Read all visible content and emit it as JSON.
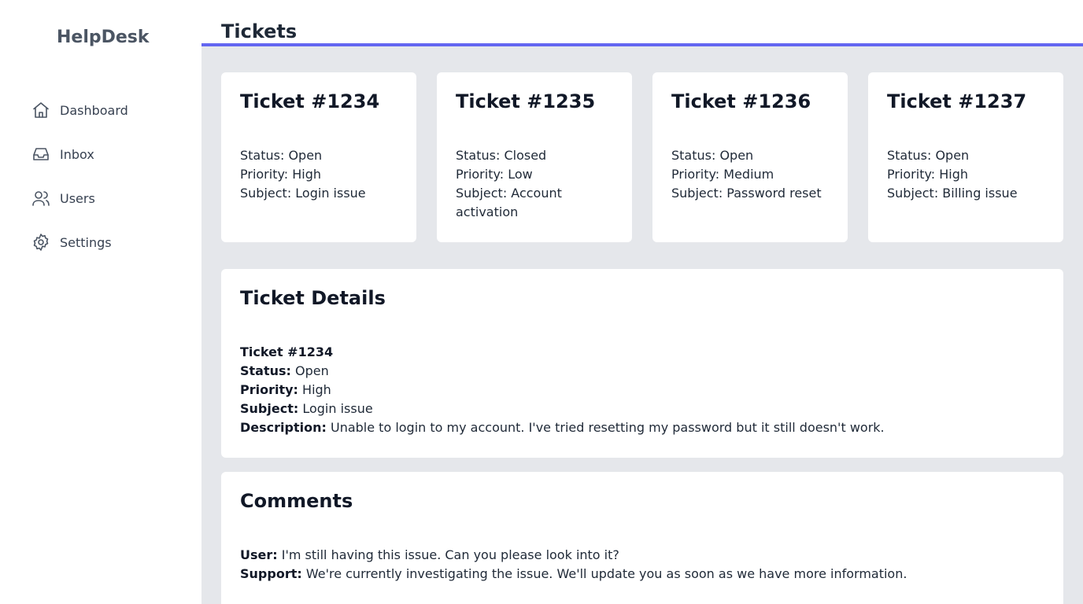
{
  "app": {
    "brand": "HelpDesk"
  },
  "sidebar": {
    "items": [
      {
        "label": "Dashboard",
        "icon": "home-icon"
      },
      {
        "label": "Inbox",
        "icon": "inbox-icon"
      },
      {
        "label": "Users",
        "icon": "users-icon"
      },
      {
        "label": "Settings",
        "icon": "gear-icon"
      }
    ]
  },
  "header": {
    "title": "Tickets"
  },
  "colors": {
    "accent": "#6366f1",
    "background": "#e5e7eb"
  },
  "tickets": [
    {
      "title": "Ticket #1234",
      "status": "Status: Open",
      "priority": "Priority: High",
      "subject": "Subject: Login issue"
    },
    {
      "title": "Ticket #1235",
      "status": "Status: Closed",
      "priority": "Priority: Low",
      "subject": "Subject: Account activation"
    },
    {
      "title": "Ticket #1236",
      "status": "Status: Open",
      "priority": "Priority: Medium",
      "subject": "Subject: Password reset"
    },
    {
      "title": "Ticket #1237",
      "status": "Status: Open",
      "priority": "Priority: High",
      "subject": "Subject: Billing issue"
    }
  ],
  "details": {
    "title": "Ticket Details",
    "ticket": "Ticket #1234",
    "status_label": "Status:",
    "status_value": "Open",
    "priority_label": "Priority:",
    "priority_value": "High",
    "subject_label": "Subject:",
    "subject_value": "Login issue",
    "description_label": "Description:",
    "description_value": "Unable to login to my account. I've tried resetting my password but it still doesn't work."
  },
  "comments": {
    "title": "Comments",
    "items": [
      {
        "author": "User:",
        "text": "I'm still having this issue. Can you please look into it?"
      },
      {
        "author": "Support:",
        "text": "We're currently investigating the issue. We'll update you as soon as we have more information."
      }
    ]
  }
}
